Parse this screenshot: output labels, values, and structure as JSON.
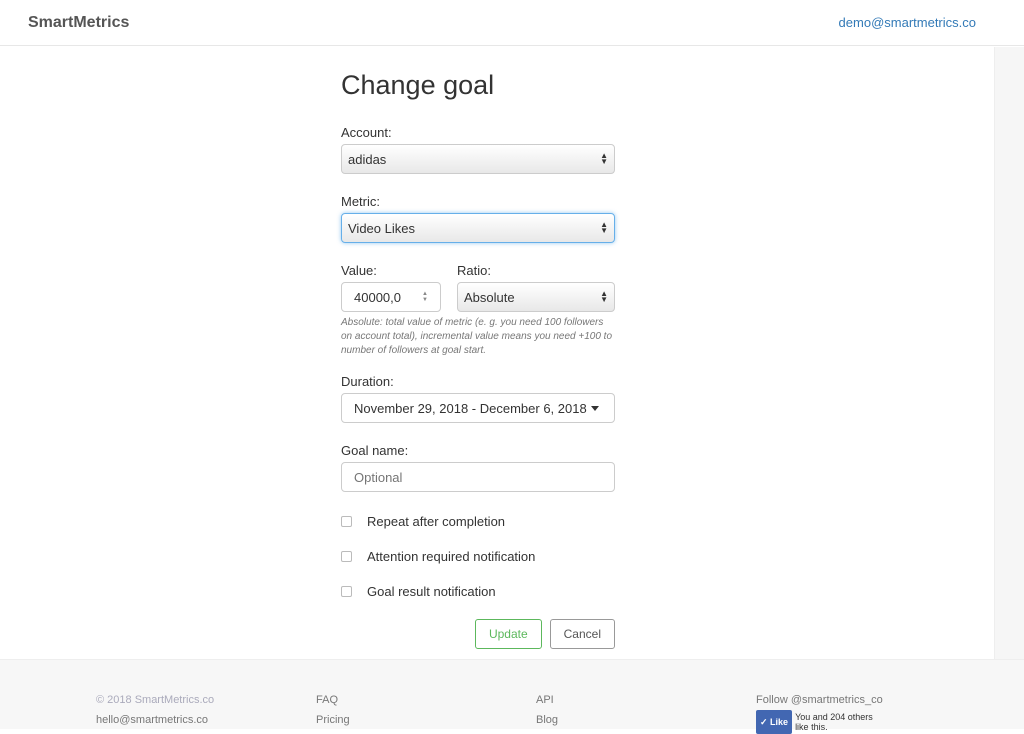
{
  "nav": {
    "brand": "SmartMetrics",
    "user": "demo@smartmetrics.co"
  },
  "form": {
    "title": "Change goal",
    "account": {
      "label": "Account:",
      "value": "adidas"
    },
    "metric": {
      "label": "Metric:",
      "value": "Video Likes"
    },
    "value": {
      "label": "Value:",
      "value": "40000,0"
    },
    "ratio": {
      "label": "Ratio:",
      "value": "Absolute"
    },
    "help": "Absolute: total value of metric (e. g. you need 100 followers on account total), incremental value means you need +100 to number of followers at goal start.",
    "duration": {
      "label": "Duration:",
      "value": "November 29, 2018 - December 6, 2018"
    },
    "goal_name": {
      "label": "Goal name:",
      "placeholder": "Optional"
    },
    "checkboxes": [
      "Repeat after completion",
      "Attention required notification",
      "Goal result notification"
    ],
    "update": "Update",
    "cancel": "Cancel"
  },
  "footer": {
    "copyright": "© 2018 SmartMetrics.co",
    "email": "hello@smartmetrics.co",
    "faq": "FAQ",
    "pricing": "Pricing",
    "api": "API",
    "blog": "Blog",
    "follow": "Follow @smartmetrics_co",
    "like": "✓ Like",
    "like_text": "You and 204 others like this."
  }
}
